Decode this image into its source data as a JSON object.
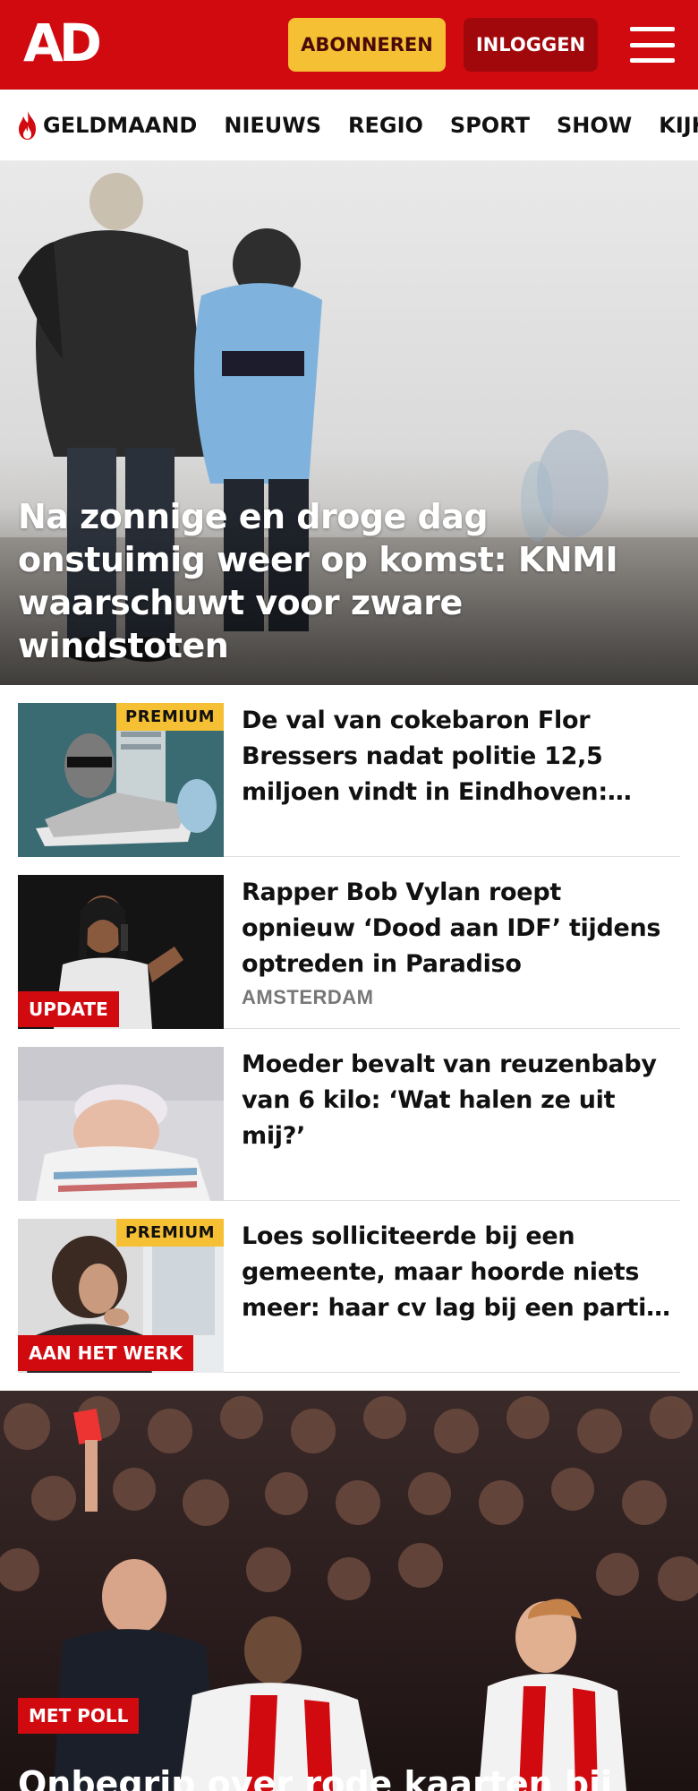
{
  "header": {
    "logo": "AD",
    "subscribe_label": "ABONNEREN",
    "login_label": "INLOGGEN"
  },
  "nav": {
    "items": [
      {
        "label": "GELDMAAND",
        "icon": "flame-icon"
      },
      {
        "label": "NIEUWS"
      },
      {
        "label": "REGIO"
      },
      {
        "label": "SPORT"
      },
      {
        "label": "SHOW"
      },
      {
        "label": "KIJK"
      }
    ]
  },
  "hero": {
    "title": "Na zonnige en droge dag onstuimig weer op komst: KNMI waarschuwt voor zware windstoten"
  },
  "articles": [
    {
      "title": "De val van cokebaron Flor Bressers nadat politie 12,5 miljoen vindt in Eindhoven: ‘Lijn…",
      "premium": "PREMIUM"
    },
    {
      "title": "Rapper Bob Vylan roept opnieuw ‘Dood aan IDF’ tijdens optreden in Paradiso",
      "meta": "AMSTERDAM",
      "tag": "UPDATE"
    },
    {
      "title": "Moeder bevalt van reuzenbaby van 6 kilo: ‘Wat halen ze uit mij?’"
    },
    {
      "title": "Loes solliciteerde bij een gemeente, maar hoorde niets meer: haar cv lag bij een partij i…",
      "premium": "PREMIUM",
      "tag": "AAN HET WERK"
    }
  ],
  "feature": {
    "tag": "MET POLL",
    "title": "Onbegrip over rode kaarten bij"
  },
  "colors": {
    "brand_red": "#d10a10",
    "premium_yellow": "#f5c033",
    "login_dark_red": "#a0080c"
  }
}
